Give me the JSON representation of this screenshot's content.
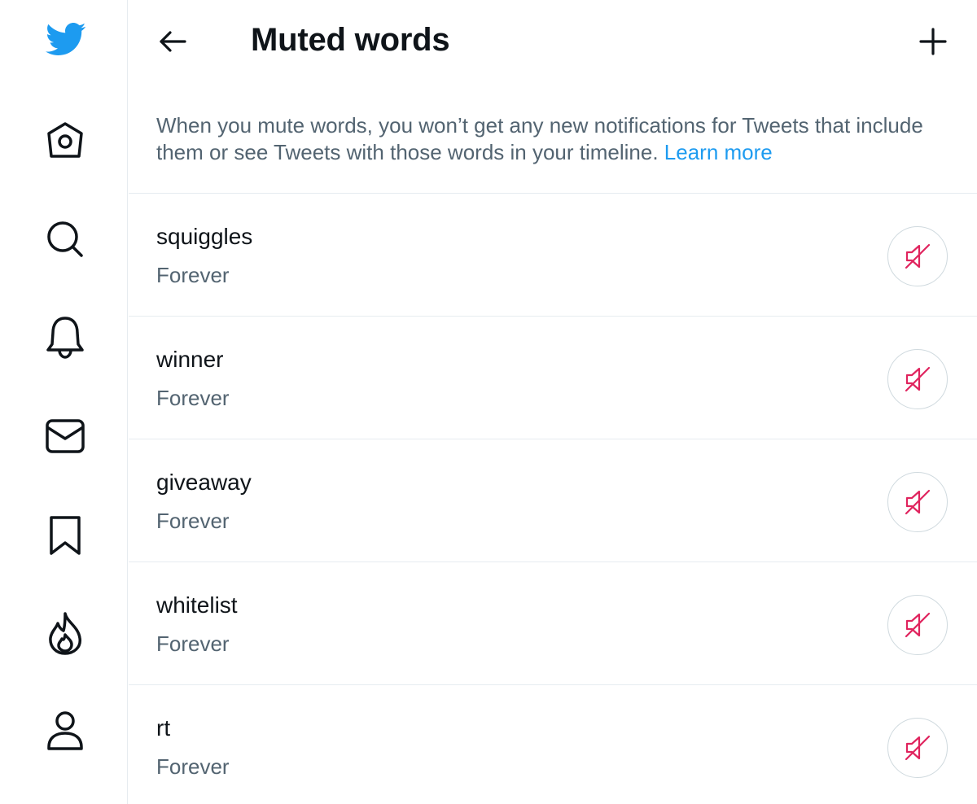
{
  "colors": {
    "brand": "#1d9bf0",
    "unmute_icon": "#e0245e",
    "secondary_text": "#536471",
    "divider": "#e6ecf0"
  },
  "sidebar": {
    "items": [
      {
        "icon": "twitter-logo-icon"
      },
      {
        "icon": "home-icon"
      },
      {
        "icon": "search-icon"
      },
      {
        "icon": "notifications-bell-icon"
      },
      {
        "icon": "messages-envelope-icon"
      },
      {
        "icon": "bookmark-icon"
      },
      {
        "icon": "trending-flame-icon"
      },
      {
        "icon": "profile-person-icon"
      }
    ]
  },
  "header": {
    "back_icon": "back-arrow-icon",
    "title": "Muted words",
    "add_icon": "plus-icon"
  },
  "description": {
    "text": "When you mute words, you won’t get any new notifications for Tweets that include them or see Tweets with those words in your timeline. ",
    "link": "Learn more"
  },
  "muted_words": [
    {
      "word": "squiggles",
      "duration": "Forever",
      "action_icon": "unmute-speaker-slash-icon"
    },
    {
      "word": "winner",
      "duration": "Forever",
      "action_icon": "unmute-speaker-slash-icon"
    },
    {
      "word": "giveaway",
      "duration": "Forever",
      "action_icon": "unmute-speaker-slash-icon"
    },
    {
      "word": "whitelist",
      "duration": "Forever",
      "action_icon": "unmute-speaker-slash-icon"
    },
    {
      "word": "rt",
      "duration": "Forever",
      "action_icon": "unmute-speaker-slash-icon"
    }
  ]
}
